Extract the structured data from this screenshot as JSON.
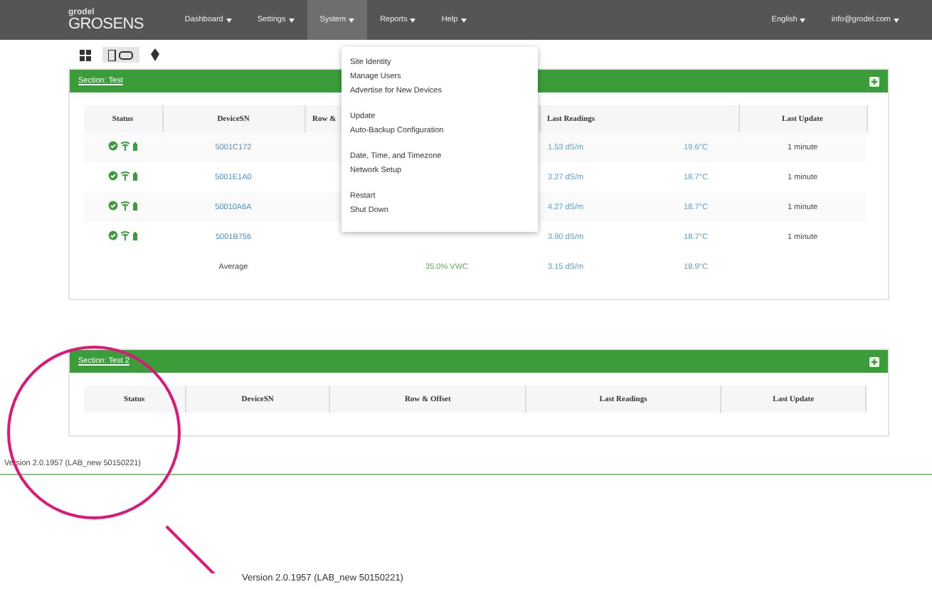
{
  "navbar": {
    "logo_top": "grodel",
    "logo": "GROSENS",
    "items": [
      {
        "label": "Dashboard",
        "selected": false
      },
      {
        "label": "Settings",
        "selected": false
      },
      {
        "label": "System",
        "selected": true
      },
      {
        "label": "Reports",
        "selected": false
      },
      {
        "label": "Help",
        "selected": false
      }
    ],
    "right_items": [
      "English",
      "info@grodel.com"
    ]
  },
  "dropdown": {
    "groups": [
      [
        "Site Identity",
        "Manage Users",
        "Advertise for New Devices"
      ],
      [
        "Update",
        "Auto-Backup Configuration"
      ],
      [
        "Date, Time, and Timezone",
        "Network Setup"
      ],
      [
        "Restart",
        "Shut Down"
      ]
    ]
  },
  "toolbar": {
    "views": [
      {
        "selected": false
      },
      {
        "selected": true
      },
      {
        "selected": false
      }
    ]
  },
  "sections": [
    {
      "title": "Section: Test",
      "columns": [
        "Status",
        "DeviceSN",
        "Row &",
        "Last Readings",
        "Last Update"
      ],
      "rows": [
        {
          "device_sn": "5001C172",
          "reading_1": "1.53 dS/m",
          "reading_2": "19.6°C",
          "last_update": "1 minute"
        },
        {
          "device_sn": "5001E1A0",
          "reading_1": "3.27 dS/m",
          "reading_2": "18.7°C",
          "last_update": "1 minute"
        },
        {
          "device_sn": "50010A6A",
          "reading_1": "4.27 dS/m",
          "reading_2": "18.7°C",
          "last_update": "1 minute"
        },
        {
          "device_sn": "5001B756",
          "reading_1": "3.90 dS/m",
          "reading_2": "18.7°C",
          "last_update": "1 minute"
        }
      ],
      "average": {
        "label": "Average",
        "row_offset": "35.0% VWC",
        "reading_1": "3.15 dS/m",
        "reading_2": "18.9°C"
      }
    },
    {
      "title": "Section: Test 2",
      "columns": [
        "Status",
        "DeviceSN",
        "Row & Offset",
        "Last Readings",
        "Last Update"
      ]
    }
  ],
  "footer": {
    "version": "Version 2.0.1957 (LAB_new 50150221)"
  },
  "callout": {
    "text": "Version 2.0.1957 (LAB_new 50150221)"
  }
}
